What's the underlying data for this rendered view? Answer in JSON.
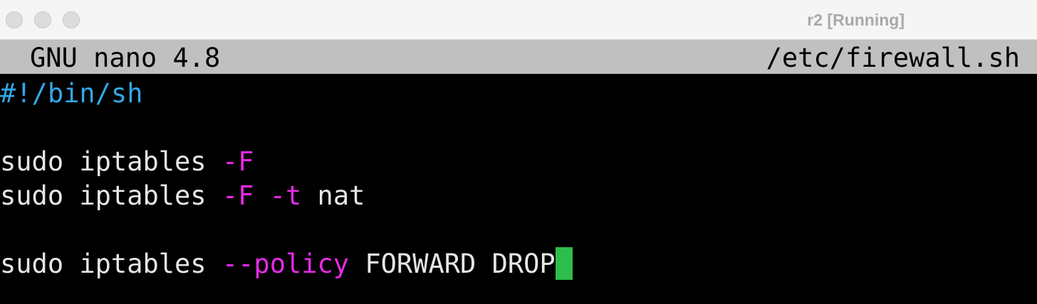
{
  "window": {
    "title": "r2 [Running]"
  },
  "nano": {
    "version_label": "GNU nano 4.8",
    "filename": "/etc/firewall.sh"
  },
  "code": {
    "line1": "#!/bin/sh",
    "line3_cmd": "sudo iptables ",
    "line3_flag": "-F",
    "line4_cmd": "sudo iptables ",
    "line4_flag1": "-F",
    "line4_sep": " ",
    "line4_flag2": "-t",
    "line4_arg": " nat",
    "line6_cmd": "sudo iptables ",
    "line6_flag": "--policy",
    "line6_args": " FORWARD DROP"
  },
  "colors": {
    "comment": "#33a7e6",
    "flag": "#e72be5",
    "cursor": "#2ebd4a",
    "header_bg": "#c0c0c0"
  }
}
